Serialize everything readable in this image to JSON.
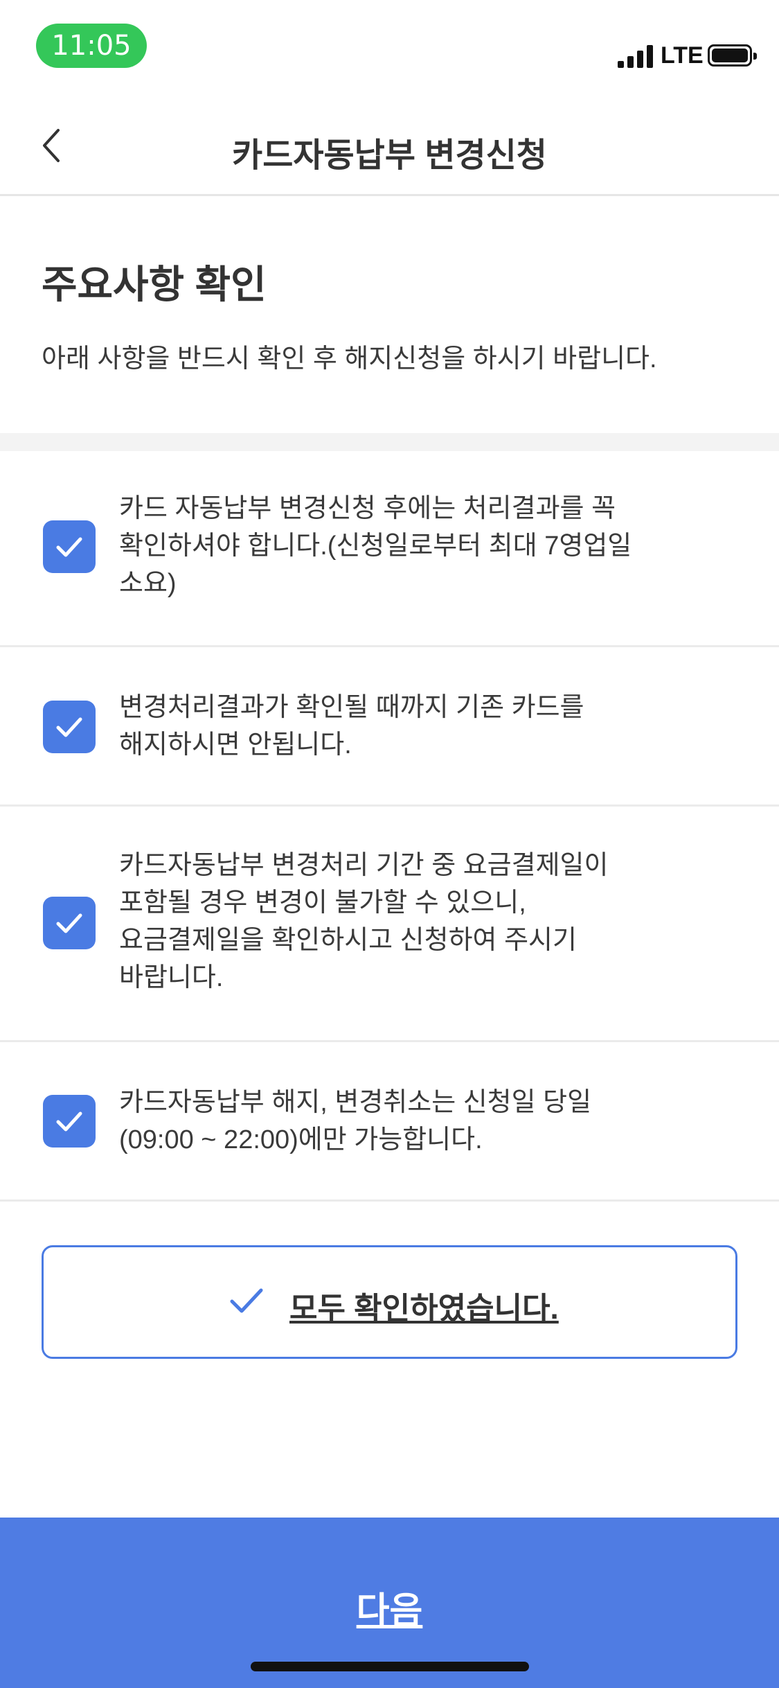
{
  "status_bar": {
    "time": "11:05",
    "network": "LTE",
    "icons": [
      "signal-icon",
      "battery-icon"
    ]
  },
  "header": {
    "title": "카드자동납부 변경신청",
    "back_icon": "chevron-left-icon"
  },
  "intro": {
    "title": "주요사항 확인",
    "description": "아래 사항을 반드시 확인 후 해지신청을 하시기 바랍니다."
  },
  "checklist": {
    "items": [
      {
        "lines": [
          "카드 자동납부 변경신청 후에는 처리결과를 꼭",
          "확인하셔야 합니다.(신청일로부터 최대 7영업일",
          "소요)"
        ],
        "checked": true
      },
      {
        "lines": [
          "변경처리결과가 확인될 때까지 기존 카드를",
          "해지하시면 안됩니다."
        ],
        "checked": true
      },
      {
        "lines": [
          "카드자동납부 변경처리 기간 중 요금결제일이",
          "포함될 경우 변경이 불가할 수 있으니,",
          "요금결제일을 확인하시고 신청하여 주시기",
          "바랍니다."
        ],
        "checked": true
      },
      {
        "lines": [
          "카드자동납부 해지, 변경취소는 신청일 당일",
          "(09:00 ~ 22:00)에만 가능합니다."
        ],
        "checked": true
      }
    ]
  },
  "confirm_all": {
    "label": "모두 확인하였습니다.",
    "checked": true
  },
  "footer": {
    "next_label": "다음"
  },
  "colors": {
    "accent": "#4a7be3",
    "time_pill": "#34c759",
    "button_bg": "#4f7ce3"
  }
}
